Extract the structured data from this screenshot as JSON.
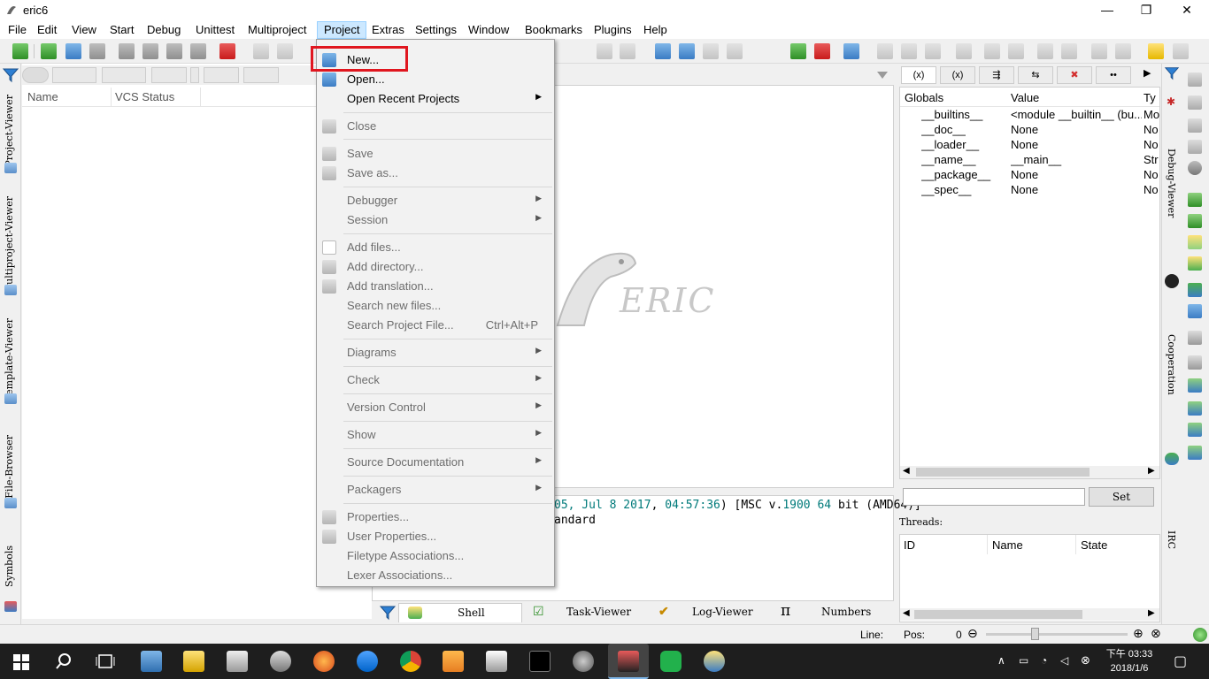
{
  "window": {
    "title": "eric6",
    "min_label": "—",
    "max_label": "❐",
    "close_label": "✕"
  },
  "menubar": {
    "items": [
      "File",
      "Edit",
      "View",
      "Start",
      "Debug",
      "Unittest",
      "Multiproject",
      "Project",
      "Extras",
      "Settings",
      "Window",
      "Bookmarks",
      "Plugins",
      "Help"
    ],
    "active": "Project"
  },
  "left_tabs": [
    "Project-Viewer",
    "Multiproject-Viewer",
    "Template-Viewer",
    "File-Browser",
    "Symbols"
  ],
  "project_viewer": {
    "columns": [
      "Name",
      "VCS Status"
    ]
  },
  "logo": {
    "text": "ERIC"
  },
  "shell": {
    "line1_a": "05, Jul  ",
    "line1_num": "8 2017",
    "line1_b": ", ",
    "line1_time": "04:57:36",
    "line1_c": ") [MSC v.",
    "line1_msc": "1900 64",
    "line1_d": " bit (AMD64)]",
    "line2": "andard"
  },
  "bottom_tabs": [
    {
      "label": "Shell",
      "active": true
    },
    {
      "label": "Task-Viewer",
      "active": false
    },
    {
      "label": "Log-Viewer",
      "active": false
    },
    {
      "label": "Numbers",
      "active": false
    }
  ],
  "debug_viewer": {
    "tab_glyphs": [
      "(x)",
      "(x)",
      "⇶",
      "⇆",
      "✖",
      "••"
    ],
    "columns": [
      "Globals",
      "Value",
      "Ty"
    ],
    "rows": [
      {
        "name": "__builtins__",
        "value": "<module __builtin__ (bu...",
        "type": "Mo"
      },
      {
        "name": "__doc__",
        "value": "None",
        "type": "No"
      },
      {
        "name": "__loader__",
        "value": "None",
        "type": "No"
      },
      {
        "name": "__name__",
        "value": "__main__",
        "type": "Str"
      },
      {
        "name": "__package__",
        "value": "None",
        "type": "No"
      },
      {
        "name": "__spec__",
        "value": "None",
        "type": "No"
      }
    ],
    "set_button": "Set",
    "threads_label": "Threads:",
    "threads_columns": [
      "ID",
      "Name",
      "State"
    ]
  },
  "right_tabs": [
    "Debug-Viewer",
    "Cooperation",
    "IRC"
  ],
  "statusbar": {
    "line_label": "Line:",
    "pos_label": "Pos:",
    "zoom_value": "0"
  },
  "taskbar": {
    "time": "下午 03:33",
    "date": "2018/1/6"
  },
  "project_menu": {
    "items": [
      {
        "label": "New...",
        "enabled": true,
        "submenu": false,
        "shortcut": ""
      },
      {
        "label": "Open...",
        "enabled": true,
        "submenu": false,
        "shortcut": ""
      },
      {
        "label": "Open Recent Projects",
        "enabled": true,
        "submenu": true,
        "shortcut": ""
      },
      {
        "label": "Close",
        "enabled": false,
        "submenu": false,
        "shortcut": ""
      },
      {
        "label": "Save",
        "enabled": false,
        "submenu": false,
        "shortcut": ""
      },
      {
        "label": "Save as...",
        "enabled": false,
        "submenu": false,
        "shortcut": ""
      },
      {
        "label": "Debugger",
        "enabled": false,
        "submenu": true,
        "shortcut": ""
      },
      {
        "label": "Session",
        "enabled": false,
        "submenu": true,
        "shortcut": ""
      },
      {
        "label": "Add files...",
        "enabled": false,
        "submenu": false,
        "shortcut": ""
      },
      {
        "label": "Add directory...",
        "enabled": false,
        "submenu": false,
        "shortcut": ""
      },
      {
        "label": "Add translation...",
        "enabled": false,
        "submenu": false,
        "shortcut": ""
      },
      {
        "label": "Search new files...",
        "enabled": false,
        "submenu": false,
        "shortcut": ""
      },
      {
        "label": "Search Project File...",
        "enabled": false,
        "submenu": false,
        "shortcut": "Ctrl+Alt+P"
      },
      {
        "label": "Diagrams",
        "enabled": false,
        "submenu": true,
        "shortcut": ""
      },
      {
        "label": "Check",
        "enabled": false,
        "submenu": true,
        "shortcut": ""
      },
      {
        "label": "Version Control",
        "enabled": false,
        "submenu": true,
        "shortcut": ""
      },
      {
        "label": "Show",
        "enabled": false,
        "submenu": true,
        "shortcut": ""
      },
      {
        "label": "Source Documentation",
        "enabled": false,
        "submenu": true,
        "shortcut": ""
      },
      {
        "label": "Packagers",
        "enabled": false,
        "submenu": true,
        "shortcut": ""
      },
      {
        "label": "Properties...",
        "enabled": false,
        "submenu": false,
        "shortcut": ""
      },
      {
        "label": "User Properties...",
        "enabled": false,
        "submenu": false,
        "shortcut": ""
      },
      {
        "label": "Filetype Associations...",
        "enabled": false,
        "submenu": false,
        "shortcut": ""
      },
      {
        "label": "Lexer Associations...",
        "enabled": false,
        "submenu": false,
        "shortcut": ""
      }
    ]
  },
  "colors": {
    "highlight": "#e0161f",
    "menu_active": "#cce8ff",
    "teal": "#007a7a"
  }
}
